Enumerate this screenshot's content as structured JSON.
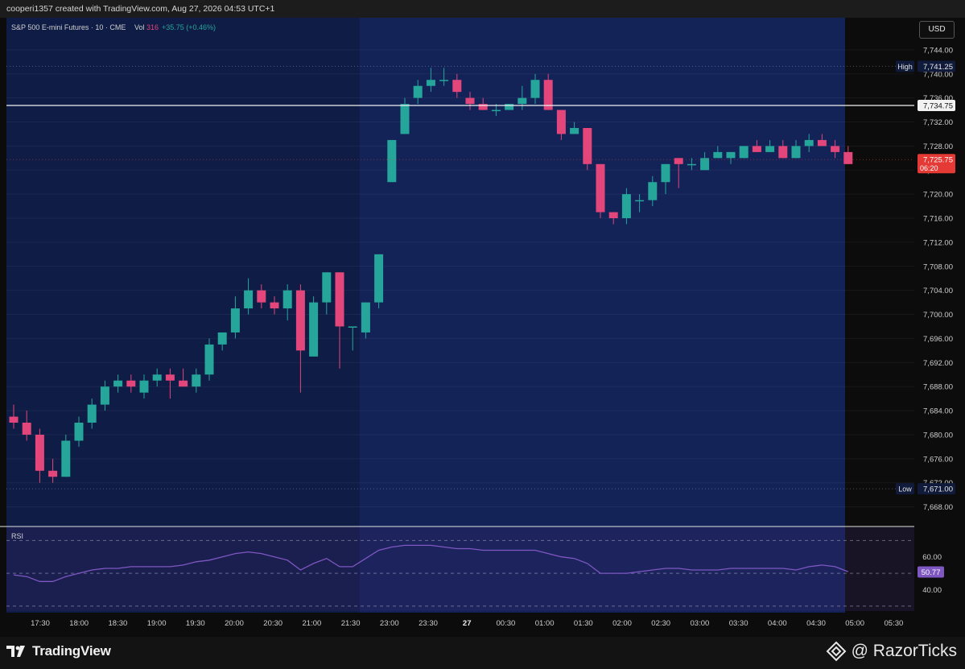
{
  "header": {
    "watermark": "cooperi1357 created with TradingView.com, Aug 27, 2026 04:53 UTC+1"
  },
  "legend": {
    "symbol": "S&P 500 E-mini Futures · 10 · CME",
    "vol_label": "Vol",
    "vol_value": "316",
    "change": "+35.75 (+0.46%)"
  },
  "currency": "USD",
  "colors": {
    "up": "#26a69a",
    "down": "#e3467a",
    "background_session": "#132257",
    "background_pre": "#0f1c45",
    "rsi_line": "#7e57c2",
    "price_tag": "#e53935"
  },
  "chart_data": {
    "type": "candlestick",
    "interval_minutes": 10,
    "time_axis": [
      "17:30",
      "18:00",
      "18:30",
      "19:00",
      "19:30",
      "20:00",
      "20:30",
      "21:00",
      "21:30",
      "23:00",
      "23:30",
      "27",
      "00:30",
      "01:00",
      "01:30",
      "02:00",
      "02:30",
      "03:00",
      "03:30",
      "04:00",
      "04:30",
      "05:00",
      "05:30"
    ],
    "ylim": [
      7665,
      7748
    ],
    "y_ticks": [
      7668,
      7672,
      7676,
      7680,
      7684,
      7688,
      7692,
      7696,
      7700,
      7704,
      7708,
      7712,
      7716,
      7720,
      7724,
      7728,
      7732,
      7736,
      7740,
      7744
    ],
    "candles": [
      {
        "o": 7683,
        "h": 7685,
        "l": 7681,
        "c": 7682
      },
      {
        "o": 7682,
        "h": 7684,
        "l": 7679,
        "c": 7680
      },
      {
        "o": 7680,
        "h": 7681,
        "l": 7672,
        "c": 7674
      },
      {
        "o": 7674,
        "h": 7676,
        "l": 7672,
        "c": 7673
      },
      {
        "o": 7673,
        "h": 7680,
        "l": 7673,
        "c": 7679
      },
      {
        "o": 7679,
        "h": 7683,
        "l": 7678,
        "c": 7682
      },
      {
        "o": 7682,
        "h": 7686,
        "l": 7681,
        "c": 7685
      },
      {
        "o": 7685,
        "h": 7689,
        "l": 7684,
        "c": 7688
      },
      {
        "o": 7688,
        "h": 7690,
        "l": 7687,
        "c": 7689
      },
      {
        "o": 7689,
        "h": 7690,
        "l": 7687,
        "c": 7688
      },
      {
        "o": 7687,
        "h": 7690,
        "l": 7686,
        "c": 7689
      },
      {
        "o": 7689,
        "h": 7691,
        "l": 7688,
        "c": 7690
      },
      {
        "o": 7690,
        "h": 7691,
        "l": 7686,
        "c": 7689
      },
      {
        "o": 7689,
        "h": 7691,
        "l": 7688,
        "c": 7688
      },
      {
        "o": 7688,
        "h": 7691,
        "l": 7687,
        "c": 7690
      },
      {
        "o": 7690,
        "h": 7696,
        "l": 7689,
        "c": 7695
      },
      {
        "o": 7695,
        "h": 7697,
        "l": 7694,
        "c": 7697
      },
      {
        "o": 7697,
        "h": 7703,
        "l": 7696,
        "c": 7701
      },
      {
        "o": 7701,
        "h": 7706,
        "l": 7700,
        "c": 7704
      },
      {
        "o": 7704,
        "h": 7705,
        "l": 7701,
        "c": 7702
      },
      {
        "o": 7702,
        "h": 7703,
        "l": 7700,
        "c": 7701
      },
      {
        "o": 7701,
        "h": 7705,
        "l": 7699,
        "c": 7704
      },
      {
        "o": 7704,
        "h": 7705,
        "l": 7687,
        "c": 7694
      },
      {
        "o": 7693,
        "h": 7703,
        "l": 7693,
        "c": 7702
      },
      {
        "o": 7702,
        "h": 7707,
        "l": 7700,
        "c": 7707
      },
      {
        "o": 7707,
        "h": 7707,
        "l": 7691,
        "c": 7698
      },
      {
        "o": 7698,
        "h": 7698,
        "l": 7694,
        "c": 7698
      },
      {
        "o": 7697,
        "h": 7702,
        "l": 7696,
        "c": 7702
      },
      {
        "o": 7702,
        "h": 7710,
        "l": 7701,
        "c": 7710
      },
      {
        "o": 7722,
        "h": 7729,
        "l": 7722,
        "c": 7729
      },
      {
        "o": 7730,
        "h": 7736,
        "l": 7730,
        "c": 7735
      },
      {
        "o": 7736,
        "h": 7739,
        "l": 7735,
        "c": 7738
      },
      {
        "o": 7738,
        "h": 7741,
        "l": 7737,
        "c": 7739
      },
      {
        "o": 7739,
        "h": 7741,
        "l": 7738,
        "c": 7739
      },
      {
        "o": 7739,
        "h": 7740,
        "l": 7736,
        "c": 7737
      },
      {
        "o": 7736,
        "h": 7737,
        "l": 7734,
        "c": 7735
      },
      {
        "o": 7735,
        "h": 7736,
        "l": 7734,
        "c": 7734
      },
      {
        "o": 7734,
        "h": 7735,
        "l": 7733,
        "c": 7734
      },
      {
        "o": 7734,
        "h": 7735,
        "l": 7734,
        "c": 7735
      },
      {
        "o": 7735,
        "h": 7738,
        "l": 7734,
        "c": 7736
      },
      {
        "o": 7736,
        "h": 7740,
        "l": 7735,
        "c": 7739
      },
      {
        "o": 7739,
        "h": 7740,
        "l": 7734,
        "c": 7734
      },
      {
        "o": 7734,
        "h": 7734,
        "l": 7729,
        "c": 7730
      },
      {
        "o": 7730,
        "h": 7732,
        "l": 7730,
        "c": 7731
      },
      {
        "o": 7731,
        "h": 7731,
        "l": 7724,
        "c": 7725
      },
      {
        "o": 7725,
        "h": 7725,
        "l": 7716,
        "c": 7717
      },
      {
        "o": 7717,
        "h": 7717,
        "l": 7715,
        "c": 7716
      },
      {
        "o": 7716,
        "h": 7721,
        "l": 7715,
        "c": 7720
      },
      {
        "o": 7719,
        "h": 7720,
        "l": 7717,
        "c": 7719
      },
      {
        "o": 7719,
        "h": 7723,
        "l": 7718,
        "c": 7722
      },
      {
        "o": 7722,
        "h": 7725,
        "l": 7720,
        "c": 7725
      },
      {
        "o": 7726,
        "h": 7726,
        "l": 7721,
        "c": 7725
      },
      {
        "o": 7725,
        "h": 7726,
        "l": 7724,
        "c": 7725
      },
      {
        "o": 7724,
        "h": 7727,
        "l": 7724,
        "c": 7726
      },
      {
        "o": 7726,
        "h": 7728,
        "l": 7726,
        "c": 7727
      },
      {
        "o": 7726,
        "h": 7727,
        "l": 7725,
        "c": 7727
      },
      {
        "o": 7726,
        "h": 7728,
        "l": 7726,
        "c": 7728
      },
      {
        "o": 7728,
        "h": 7729,
        "l": 7727,
        "c": 7727
      },
      {
        "o": 7727,
        "h": 7729,
        "l": 7727,
        "c": 7728
      },
      {
        "o": 7728,
        "h": 7729,
        "l": 7726,
        "c": 7726
      },
      {
        "o": 7726,
        "h": 7729,
        "l": 7726,
        "c": 7728
      },
      {
        "o": 7728,
        "h": 7730,
        "l": 7727,
        "c": 7729
      },
      {
        "o": 7729,
        "h": 7730,
        "l": 7728,
        "c": 7728
      },
      {
        "o": 7728,
        "h": 7729,
        "l": 7726,
        "c": 7727
      },
      {
        "o": 7727,
        "h": 7728,
        "l": 7725,
        "c": 7725
      }
    ],
    "pre_session_candle_count": 27,
    "markers": {
      "high": {
        "label": "High",
        "value": 7741.25,
        "text": "7,741.25"
      },
      "low": {
        "label": "Low",
        "value": 7671.0,
        "text": "7,671.00"
      },
      "hline": {
        "value": 7734.75,
        "text": "7,734.75"
      },
      "last": {
        "value": 7725.75,
        "text": "7,725.75",
        "countdown": "06:20"
      }
    },
    "rsi": {
      "label": "RSI",
      "current": 50.77,
      "current_text": "50.77",
      "levels": [
        70,
        50,
        30
      ],
      "ticks": [
        60,
        40
      ],
      "ylim": [
        27,
        78
      ],
      "values": [
        49,
        48,
        45,
        45,
        48,
        50,
        52,
        53,
        53,
        54,
        54,
        54,
        54,
        55,
        57,
        58,
        60,
        62,
        63,
        62,
        60,
        58,
        52,
        56,
        59,
        54,
        54,
        59,
        64,
        66,
        67,
        67,
        67,
        66,
        65,
        65,
        64,
        64,
        64,
        64,
        64,
        62,
        60,
        59,
        56,
        50,
        50,
        50,
        51,
        52,
        53,
        53,
        52,
        52,
        52,
        53,
        53,
        53,
        53,
        53,
        52,
        54,
        55,
        54,
        51
      ]
    }
  }
}
